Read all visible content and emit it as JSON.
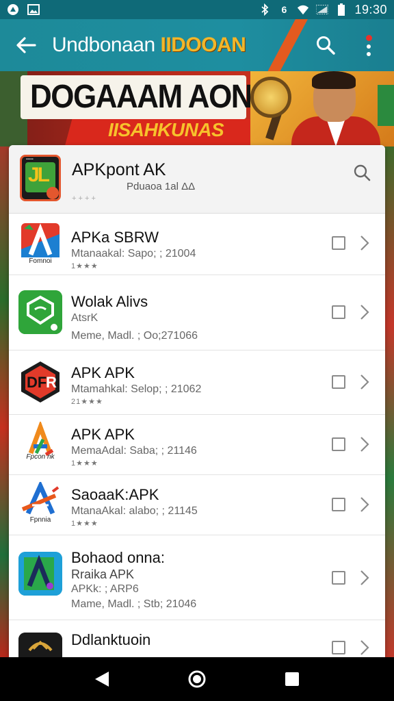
{
  "status_bar": {
    "time": "19:30",
    "left_icons": [
      "notification-icon",
      "image-icon"
    ],
    "right_icons": [
      "bluetooth-icon",
      "nfc-icon",
      "wifi-icon",
      "signal-icon",
      "battery-icon"
    ],
    "indicator_text": "6"
  },
  "app_bar": {
    "title_main": "Undbonaan",
    "title_accent": "IIDOOAN",
    "colors": {
      "bar": "#1d8a99",
      "accent": "#f2b62a",
      "menu_dot": "#e8322a"
    }
  },
  "banner": {
    "headline": "DOGAAAM AONSIN",
    "subline": "IISAHKUNAS"
  },
  "featured": {
    "icon_glyph": "JL",
    "name": "APKpont AK",
    "subtitle": "Pduaoa 1al ΔΔ",
    "extra": "+ + + +"
  },
  "items": [
    {
      "title": "APKa SBRW",
      "line1": "Mtanaakal: Sapo; ; 21004",
      "line2": "",
      "stars": "1★★★",
      "icon_label": "Fomnoi"
    },
    {
      "title": "Wolak Alivs",
      "line1": "AtsrK",
      "line2": "Meme, Madl. ; Oo;271066",
      "stars": "",
      "icon_label": ""
    },
    {
      "title": "APK APK",
      "line1": "Mtamahkal: Selop; ; 21062",
      "line2": "",
      "stars": "21★★★",
      "icon_label": ""
    },
    {
      "title": "APK APK",
      "line1": "MemaAdal: Saba; ; 21146",
      "line2": "",
      "stars": "1★★★",
      "icon_label": "Fpcon nk"
    },
    {
      "title": "SaoaaK:APK",
      "line1": "MtanaAkal: alabo; ; 21145",
      "line2": "",
      "stars": "1★★★",
      "icon_label": "Fpnnia"
    },
    {
      "title": "Bohaod onna:",
      "line1": "Rraika APK",
      "line2": "APKk: ; ARP6",
      "line3": "Mame, Madl. ; Stb; 21046",
      "stars": "",
      "icon_label": ""
    },
    {
      "title": "Ddlanktuoin",
      "line1": "",
      "line2": "",
      "stars": "",
      "icon_label": ""
    }
  ],
  "nav": {
    "back": "nav-back-icon",
    "home": "nav-home-icon",
    "recents": "nav-recents-icon"
  }
}
